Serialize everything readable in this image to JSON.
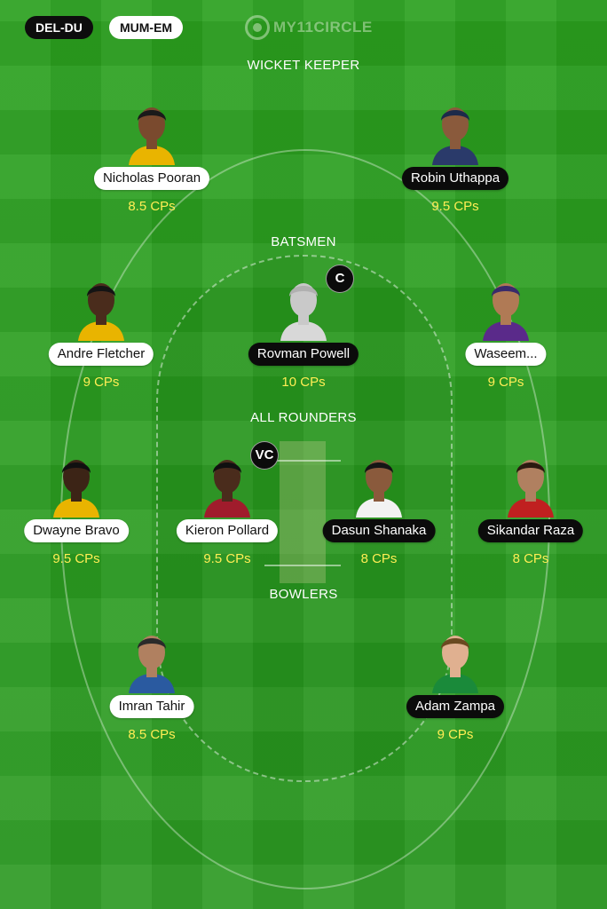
{
  "tabs": [
    {
      "label": "DEL-DU",
      "active": true
    },
    {
      "label": "MUM-EM",
      "active": false
    }
  ],
  "watermark": {
    "text": "MY11CIRCLE",
    "icon": "my11circle-logo-icon"
  },
  "sections": {
    "wicket_keeper": "WICKET KEEPER",
    "batsmen": "BATSMEN",
    "all_rounders": "ALL ROUNDERS",
    "bowlers": "BOWLERS"
  },
  "badges": {
    "captain": "C",
    "vice_captain": "VC"
  },
  "players": {
    "pooran": {
      "name": "Nicholas Pooran",
      "credits": "8.5 CPs",
      "pill": "light",
      "skin": "#7a4a2e",
      "shirt": "#e9b400",
      "hair": "#1a1a1a"
    },
    "uthappa": {
      "name": "Robin Uthappa",
      "credits": "9.5 CPs",
      "pill": "dark",
      "skin": "#8a5a3c",
      "shirt": "#2a3a6a",
      "hair": "#1c2a4a"
    },
    "fletcher": {
      "name": "Andre Fletcher",
      "credits": "9 CPs",
      "pill": "light",
      "skin": "#4a2c1c",
      "shirt": "#e9b400",
      "hair": "#141414"
    },
    "powell": {
      "name": "Rovman Powell",
      "credits": "10 CPs",
      "pill": "dark",
      "skin": "#c9c9c9",
      "shirt": "#d8d8d8",
      "hair": "#b0b0b0"
    },
    "waseem": {
      "name": "Waseem...",
      "credits": "9 CPs",
      "pill": "light",
      "skin": "#b07a55",
      "shirt": "#5a2a8a",
      "hair": "#3a2a6a"
    },
    "bravo": {
      "name": "Dwayne Bravo",
      "credits": "9.5 CPs",
      "pill": "light",
      "skin": "#3c2416",
      "shirt": "#e9b400",
      "hair": "#101010"
    },
    "pollard": {
      "name": "Kieron Pollard",
      "credits": "9.5 CPs",
      "pill": "light",
      "skin": "#4a2c1c",
      "shirt": "#a01c2c",
      "hair": "#101010"
    },
    "shanaka": {
      "name": "Dasun Shanaka",
      "credits": "8 CPs",
      "pill": "dark",
      "skin": "#8a5a3c",
      "shirt": "#f2f2f2",
      "hair": "#151515"
    },
    "raza": {
      "name": "Sikandar Raza",
      "credits": "8 CPs",
      "pill": "dark",
      "skin": "#b08060",
      "shirt": "#c02020",
      "hair": "#2a1a10"
    },
    "tahir": {
      "name": "Imran Tahir",
      "credits": "8.5 CPs",
      "pill": "light",
      "skin": "#b08060",
      "shirt": "#2a5aa0",
      "hair": "#2a2a2a"
    },
    "zampa": {
      "name": "Adam Zampa",
      "credits": "9 CPs",
      "pill": "dark",
      "skin": "#e0b090",
      "shirt": "#1a8a3a",
      "hair": "#6a4a20"
    }
  },
  "colors": {
    "field": "#2b9a20",
    "credits_text": "#ffee55",
    "pill_dark": "#0b0b0b",
    "pill_light": "#ffffff"
  }
}
